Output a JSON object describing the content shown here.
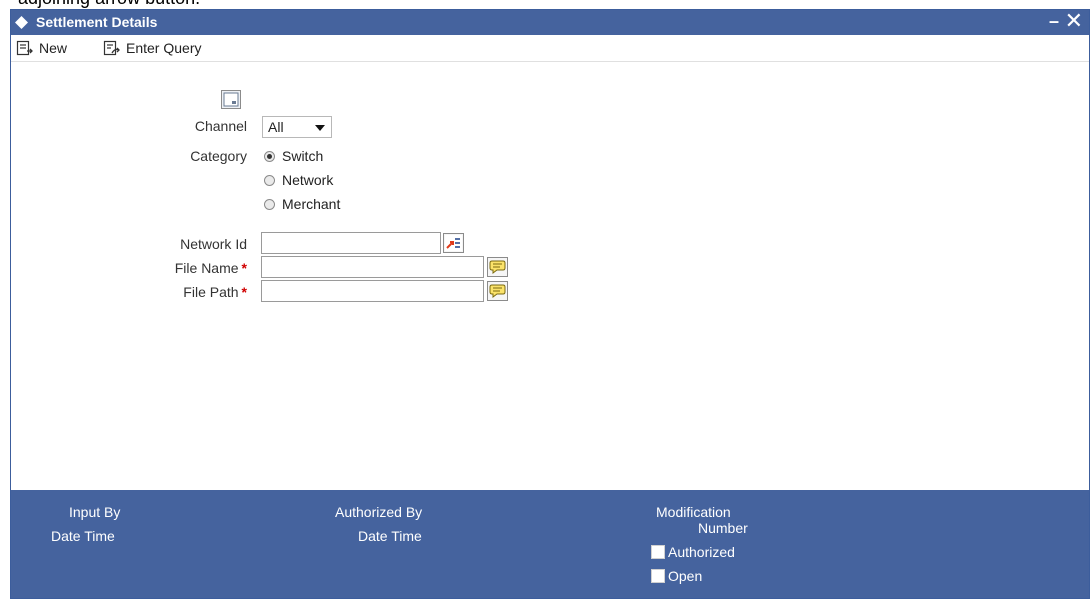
{
  "top_caption": "adjoining arrow button.",
  "window": {
    "title": "Settlement Details",
    "minimize": "–",
    "close": "✕"
  },
  "toolbar": {
    "new_label": "New",
    "enter_query_label": "Enter Query"
  },
  "form": {
    "channel": {
      "label": "Channel",
      "value": "All"
    },
    "category": {
      "label": "Category",
      "options": [
        "Switch",
        "Network",
        "Merchant"
      ],
      "selected": "Switch"
    },
    "network_id": {
      "label": "Network Id",
      "value": ""
    },
    "file_name": {
      "label": "File Name",
      "required_mark": "*",
      "value": ""
    },
    "file_path": {
      "label": "File Path",
      "required_mark": "*",
      "value": ""
    }
  },
  "footer": {
    "input_by": "Input By",
    "date_time_1": "Date Time",
    "authorized_by": "Authorized By",
    "date_time_2": "Date Time",
    "modification": "Modification",
    "number": "Number",
    "authorized": "Authorized",
    "open": "Open"
  },
  "colors": {
    "header_blue": "#45639e",
    "required_red": "#d00000"
  }
}
